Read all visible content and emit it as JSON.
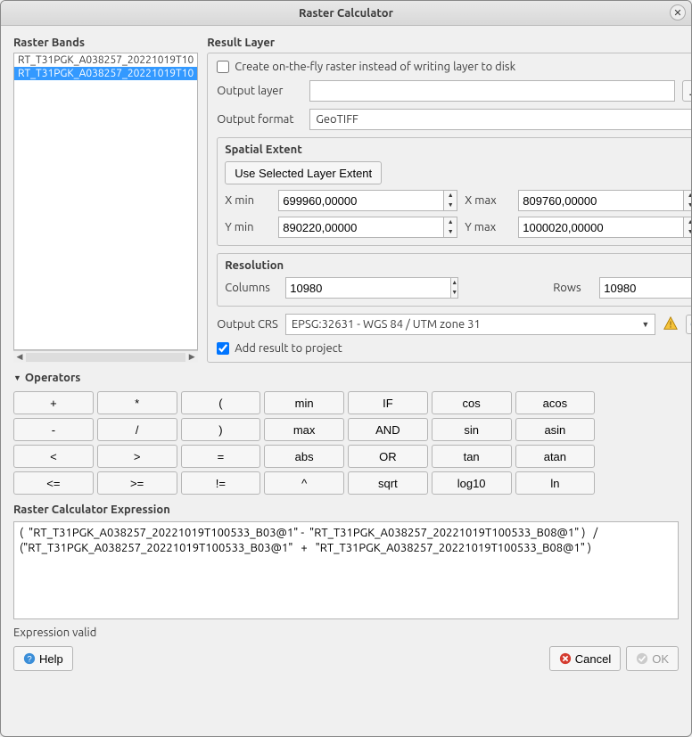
{
  "window": {
    "title": "Raster Calculator"
  },
  "bands": {
    "label": "Raster Bands",
    "items": [
      "RT_T31PGK_A038257_20221019T10",
      "RT_T31PGK_A038257_20221019T10"
    ],
    "selected_index": 1
  },
  "result": {
    "label": "Result Layer",
    "onthefly_label": "Create on-the-fly raster instead of writing layer to disk",
    "onthefly_checked": false,
    "output_layer_label": "Output layer",
    "output_layer_value": "",
    "browse_label": "…",
    "output_format_label": "Output format",
    "output_format_value": "GeoTIFF",
    "spatial_extent": {
      "label": "Spatial Extent",
      "use_selected_btn": "Use Selected Layer Extent",
      "xmin_label": "X min",
      "xmin": "699960,00000",
      "xmax_label": "X max",
      "xmax": "809760,00000",
      "ymin_label": "Y min",
      "ymin": "890220,00000",
      "ymax_label": "Y max",
      "ymax": "1000020,00000"
    },
    "resolution": {
      "label": "Resolution",
      "columns_label": "Columns",
      "columns": "10980",
      "rows_label": "Rows",
      "rows": "10980"
    },
    "crs_label": "Output CRS",
    "crs_value": "EPSG:32631 - WGS 84 / UTM zone 31",
    "add_result_label": "Add result to project",
    "add_result_checked": true
  },
  "operators": {
    "label": "Operators",
    "buttons": [
      "+",
      "*",
      "(",
      "min",
      "IF",
      "cos",
      "acos",
      "",
      "-",
      "/",
      ")",
      "max",
      "AND",
      "sin",
      "asin",
      "",
      "<",
      ">",
      "=",
      "abs",
      "OR",
      "tan",
      "atan",
      "",
      "<=",
      ">=",
      "!=",
      "^",
      "sqrt",
      "log10",
      "ln",
      ""
    ]
  },
  "expression": {
    "label": "Raster Calculator Expression",
    "value": "(  \"RT_T31PGK_A038257_20221019T100533_B03@1\" -  \"RT_T31PGK_A038257_20221019T100533_B08@1\" )   /  (\"RT_T31PGK_A038257_20221019T100533_B03@1\"   +   \"RT_T31PGK_A038257_20221019T100533_B08@1\" )"
  },
  "status": "Expression valid",
  "buttons": {
    "help": "Help",
    "cancel": "Cancel",
    "ok": "OK"
  }
}
